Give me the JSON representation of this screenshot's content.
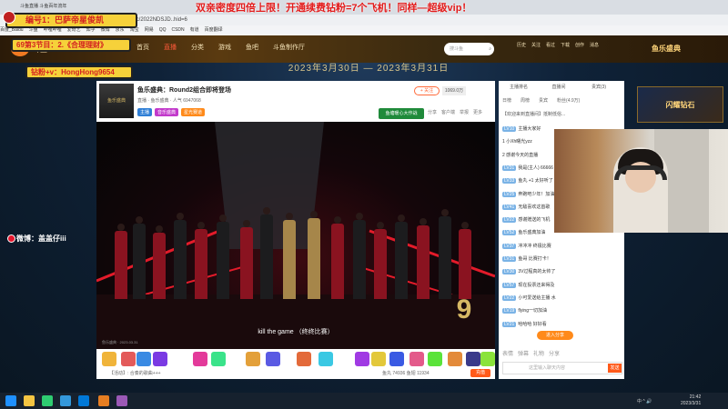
{
  "overlays": {
    "top_red": "双亲密度四倍上限！开通续费钻粉=7个飞机！同样—超级vip！",
    "gold_1": "编号1：巴萨帝星俊凯",
    "gold_2": "69第3节目：2.《合理理财》",
    "gold_3": "钻粉+v：HongHong9654",
    "weibo": "微博：盖盖仔iii"
  },
  "browser": {
    "tab_title": "斗鱼直播 斗鱼百年流年",
    "url": "topic/2022NDSJD..hid=6",
    "bookmarks": [
      "百度_Baidu",
      "斗鱼",
      "哔哩哔哩",
      "爱奇艺",
      "知乎",
      "微博",
      "京东",
      "淘宝",
      "网易",
      "QQ",
      "CSDN",
      "有道",
      "百度翻译"
    ]
  },
  "site": {
    "nav": [
      "首页",
      "直播",
      "分类",
      "游戏",
      "鱼吧",
      "斗鱼制作厅"
    ],
    "active_nav": "直播",
    "search_placeholder": "搜斗鱼",
    "header_icons": [
      "历史",
      "关注",
      "看过",
      "下载",
      "创作",
      "消息"
    ],
    "event_badge": "鱼乐盛典",
    "date_banner": "2023年3月30日 — 2023年3月31日"
  },
  "room": {
    "thumb_label": "鱼乐盛典",
    "title": "鱼乐盛典：Round2组合即将登场",
    "meta": "直播 · 鱼乐盛典 · 人气 6947068",
    "tags": [
      "主播",
      "音乐盛典",
      "星光赛道"
    ],
    "follow_label": "+ 关注",
    "follow_count": "1069.0万",
    "control_label": "鱼塘暖心大作战",
    "control_icons": [
      "分享",
      "客户端",
      "举报",
      "更多"
    ]
  },
  "video": {
    "subtitle": "kill the game （终终比赛）",
    "corner_watermark": "鱼乐盛典 · 2023.03.31",
    "big_logo": "9"
  },
  "gifts": {
    "label": "【活动】: 合奏的歌曲+++",
    "bottom_right": "鱼丸 74936  鱼翅 11934",
    "recharge": "充值"
  },
  "chat": {
    "tabs": [
      "主播排名",
      "直播间",
      "贵宾(3)"
    ],
    "subtabs": [
      "日榜",
      "周榜",
      "贵宾",
      "粉丝(4.9万)"
    ],
    "notice": "【欢迎来到直播间】抵制低俗...",
    "lines": [
      {
        "level": "LV10",
        "text": "主播大家好"
      },
      {
        "level": "",
        "text": "1 小Xh曙光yzz"
      },
      {
        "level": "",
        "text": "2 感谢今天的直播"
      },
      {
        "level": "LV31",
        "text": "我是(主人) 66666"
      },
      {
        "level": "LV33",
        "text": "鱼丸 +1 太好听了"
      },
      {
        "level": "LV25",
        "text": "奔跑吧少年！加油"
      },
      {
        "level": "LV41",
        "text": "无敌喜欢这首歌"
      },
      {
        "level": "LV22",
        "text": "感谢赠送的飞机"
      },
      {
        "level": "LV52",
        "text": "鱼乐盛典加油"
      },
      {
        "level": "LV37",
        "text": "冲冲冲 终极比赛"
      },
      {
        "level": "LV31",
        "text": "鱼哥 比赛打卡！"
      },
      {
        "level": "LV30",
        "text": "3V过程真的太帅了"
      },
      {
        "level": "LV57",
        "text": "现在投票还来得及"
      },
      {
        "level": "LV22",
        "text": "小可爱送给主播 水"
      },
      {
        "level": "LV19",
        "text": "flying一切加油"
      },
      {
        "level": "LV21",
        "text": "哈哈哈 好好看"
      }
    ],
    "enter_btn": "进入分享",
    "input_placeholder": "这里输入聊天内容",
    "send": "发送",
    "toolbar_icons": [
      "表情",
      "弹幕",
      "礼物",
      "分享"
    ]
  },
  "webcam": {
    "present": true
  },
  "ad": "闪耀钻石",
  "taskbar": {
    "time": "21:42",
    "date": "2023/3/31",
    "tray": "中 ^ 🔊"
  }
}
